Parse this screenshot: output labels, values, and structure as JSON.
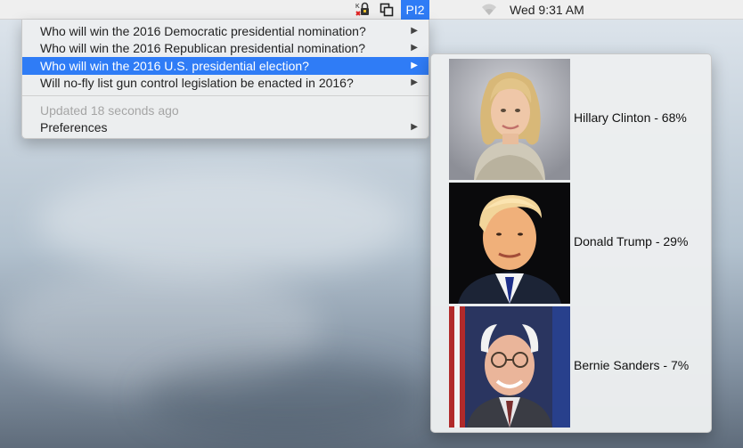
{
  "menubar": {
    "app_label": "PI2",
    "clock": "Wed 9:31 AM",
    "icons": [
      "keychain-lock-icon",
      "window-switch-icon",
      "wifi-icon"
    ]
  },
  "menu": {
    "items": [
      {
        "label": "Who will win the 2016 Democratic presidential nomination?",
        "submenu": true
      },
      {
        "label": "Who will win the 2016 Republican presidential nomination?",
        "submenu": true
      },
      {
        "label": "Who will win the 2016 U.S. presidential election?",
        "submenu": true,
        "selected": true
      },
      {
        "label": "Will no-fly list gun control legislation be enacted in 2016?",
        "submenu": true
      }
    ],
    "status": "Updated 18 seconds ago",
    "preferences": "Preferences"
  },
  "submenu": {
    "candidates": [
      {
        "label": "Hillary Clinton - 68%",
        "name": "Hillary Clinton",
        "probability": 68
      },
      {
        "label": "Donald Trump - 29%",
        "name": "Donald Trump",
        "probability": 29
      },
      {
        "label": "Bernie Sanders - 7%",
        "name": "Bernie Sanders",
        "probability": 7
      }
    ]
  },
  "colors": {
    "accent": "#2f7cf6",
    "menu_bg": "#eceef0"
  }
}
